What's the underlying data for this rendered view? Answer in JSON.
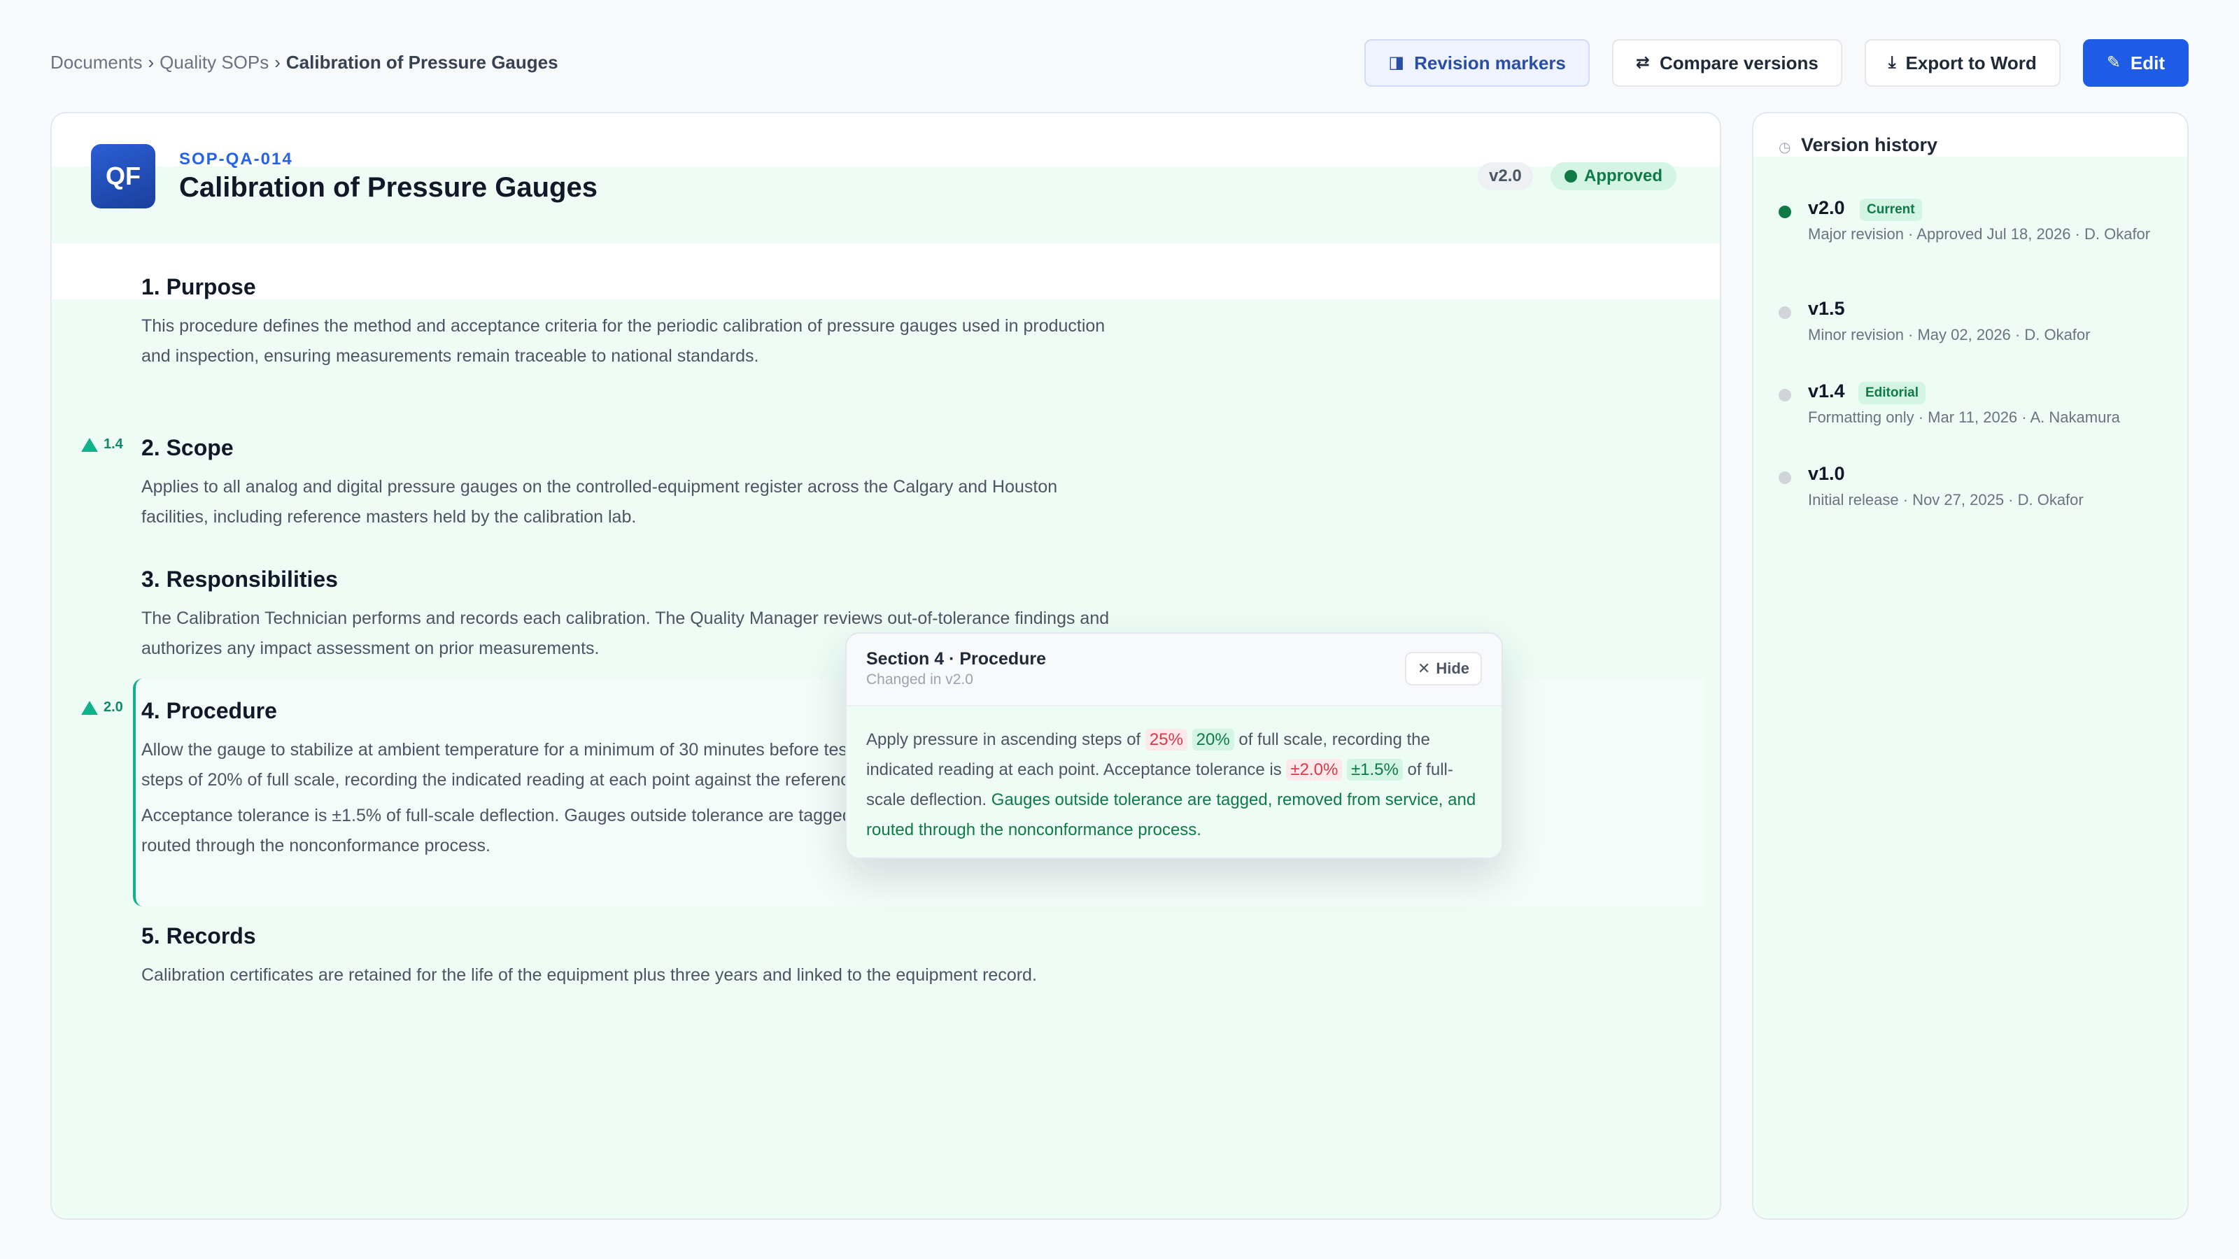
{
  "breadcrumb": {
    "items": [
      "Documents",
      "Quality SOPs"
    ],
    "current": "Calibration of Pressure Gauges",
    "separator": "›"
  },
  "toolbar": {
    "revision_markers": "Revision markers",
    "compare_versions": "Compare versions",
    "export_word": "Export to Word",
    "edit": "Edit"
  },
  "document": {
    "logo_text": "QF",
    "code": "SOP-QA-014",
    "title": "Calibration of Pressure Gauges",
    "version": "v2.0",
    "status": "Approved",
    "sections": [
      {
        "heading": "1. Purpose",
        "paragraphs": [
          "This procedure defines the method and acceptance criteria for the periodic calibration of pressure gauges used in production and inspection, ensuring measurements remain traceable to national standards."
        ]
      },
      {
        "heading": "2. Scope",
        "marker": "1.4",
        "paragraphs": [
          "Applies to all analog and digital pressure gauges on the controlled-equipment register across the Calgary and Houston facilities, including reference masters held by the calibration lab."
        ]
      },
      {
        "heading": "3. Responsibilities",
        "paragraphs": [
          "The Calibration Technician performs and records each calibration. The Quality Manager reviews out-of-tolerance findings and authorizes any impact assessment on prior measurements."
        ]
      },
      {
        "heading": "4. Procedure",
        "marker": "2.0",
        "paragraphs": [
          "Allow the gauge to stabilize at ambient temperature for a minimum of 30 minutes before testing. Apply pressure in ascending steps of 20% of full scale, recording the indicated reading at each point against the reference standard.",
          "Acceptance tolerance is ±1.5% of full-scale deflection. Gauges outside tolerance are tagged, removed from service, and routed through the nonconformance process."
        ]
      },
      {
        "heading": "5. Records",
        "paragraphs": [
          "Calibration certificates are retained for the life of the equipment plus three years and linked to the equipment record."
        ]
      }
    ]
  },
  "popover": {
    "title": "Section 4 · Procedure",
    "subtitle": "Changed in v2.0",
    "hide_label": "Hide",
    "diff": {
      "t1": "Apply pressure in ascending steps of",
      "del1": "25%",
      "ins1": "20%",
      "t2": "of full scale, recording the indicated reading at each point. Acceptance tolerance is",
      "del2": "±2.0%",
      "ins2": "±1.5%",
      "t3": "of full-scale deflection.",
      "ins3": "Gauges outside tolerance are tagged, removed from service, and routed through the nonconformance process."
    }
  },
  "history": {
    "title": "Version history",
    "items": [
      {
        "version": "v2.0",
        "badge": "Current",
        "desc": "Major revision · Approved Jul 18, 2026 · D. Okafor",
        "current": true
      },
      {
        "version": "v1.5",
        "badge": "",
        "desc": "Minor revision · May 02, 2026 · D. Okafor",
        "current": false
      },
      {
        "version": "v1.4",
        "badge": "Editorial",
        "desc": "Formatting only · Mar 11, 2026 · A. Nakamura",
        "current": false
      },
      {
        "version": "v1.0",
        "badge": "",
        "desc": "Initial release · Nov 27, 2025 · D. Okafor",
        "current": false
      }
    ]
  },
  "icons": {
    "revision": "revision-markers-icon",
    "compare": "compare-arrows-icon",
    "export": "download-icon",
    "edit": "pencil-icon",
    "close": "close-icon",
    "history": "clock-icon"
  },
  "colors": {
    "accent": "#1f5ce6",
    "approved": "#0f7a45",
    "deleted": "#d73a49",
    "marker": "#14b08a"
  }
}
